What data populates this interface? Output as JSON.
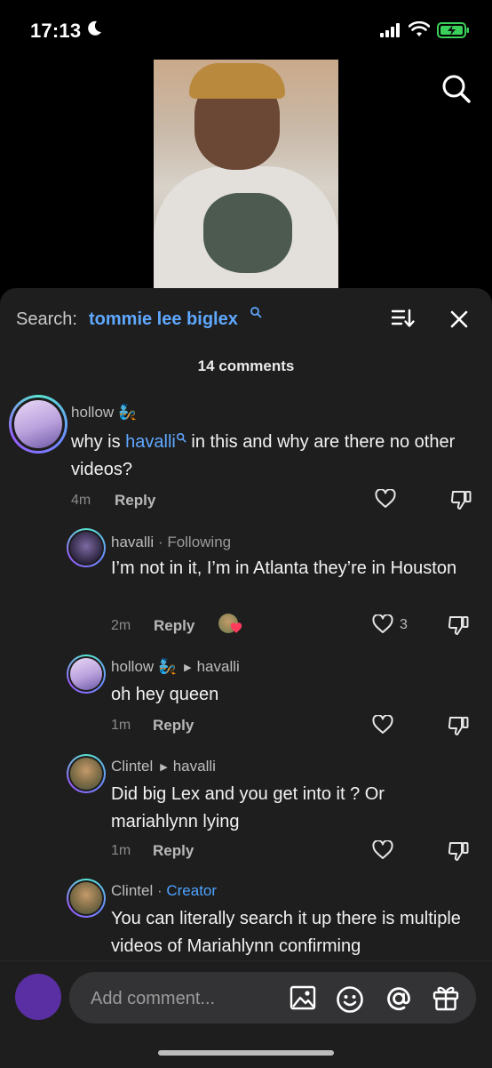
{
  "status_bar": {
    "time": "17:13"
  },
  "sheet": {
    "search_label": "Search:",
    "search_term": "tommie lee biglex",
    "comment_count": "14 comments"
  },
  "comments": [
    {
      "username": "hollow",
      "text_pre": "why is ",
      "text_link": "havalli",
      "text_post": " in this and why are there no other videos?",
      "time": "4m",
      "reply_label": "Reply"
    },
    {
      "username": "havalli",
      "tag": "Following",
      "text": "I’m not in it, I’m in Atlanta they’re in Houston",
      "time": "2m",
      "reply_label": "Reply",
      "like_count": "3"
    },
    {
      "username": "hollow",
      "reply_to": "havalli",
      "text": "oh hey queen",
      "time": "1m",
      "reply_label": "Reply"
    },
    {
      "username": "Clintel",
      "reply_to": "havalli",
      "text": "Did big Lex and you get into it ? Or mariahlynn lying",
      "time": "1m",
      "reply_label": "Reply"
    },
    {
      "username": "Clintel",
      "tag": "Creator",
      "text": "You can literally search it up there is multiple videos of Mariahlynn confirming"
    }
  ],
  "composer": {
    "placeholder": "Add comment..."
  },
  "colors": {
    "accent": "#5fa8ff",
    "sheet_bg": "#1e1e1e",
    "creator": "#4da3ff"
  }
}
